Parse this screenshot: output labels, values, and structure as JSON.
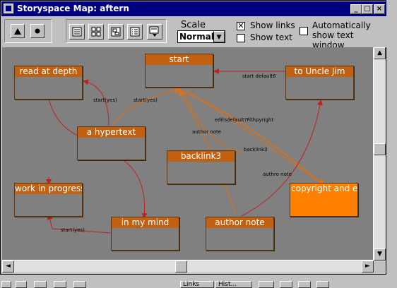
{
  "window": {
    "title": "Storyspace Map: aftern",
    "controls": {
      "minimize": "_",
      "maximize": "□",
      "close": "×"
    }
  },
  "toolbar": {
    "nav_up_icon": "triangle-up-icon",
    "nav_dot_icon": "dot-icon",
    "view_buttons": [
      "map-view-icon",
      "chart-view-icon",
      "outline-view-icon",
      "treemap-view-icon",
      "explorer-view-icon"
    ],
    "scale_label": "Scale",
    "scale_value": "Normal",
    "show_links_label": "Show links",
    "show_links_checked": true,
    "show_links_mark": "✕",
    "show_text_label": "Show text",
    "show_text_checked": false,
    "auto_text_label_line1": "Automatically",
    "auto_text_label_line2": "show text window",
    "auto_text_checked": false
  },
  "map": {
    "background": "#808080",
    "title_color": "#c06010",
    "selected_color": "#ff8000",
    "link_color_red": "#c02020",
    "link_color_orange": "#e07010",
    "nodes": [
      {
        "id": "start",
        "title": "start",
        "selected": false
      },
      {
        "id": "read-at-depth",
        "title": "read at depth",
        "selected": false
      },
      {
        "id": "to-uncle-jim",
        "title": "to Uncle Jim",
        "selected": false
      },
      {
        "id": "a-hypertext",
        "title": "a hypertext",
        "selected": false
      },
      {
        "id": "backlink3",
        "title": "backlink3",
        "selected": false
      },
      {
        "id": "copyright-and-edi",
        "title": "copyright and edi",
        "selected": true
      },
      {
        "id": "work-in-progress",
        "title": "work in progress",
        "selected": false
      },
      {
        "id": "in-my-mind",
        "title": "in my mind",
        "selected": false
      },
      {
        "id": "author-note",
        "title": "author note",
        "selected": false
      }
    ],
    "link_labels": {
      "start_default": "start default6",
      "start_yes_1": "start(yes)",
      "start_yes_2": "start(yes)",
      "edit_overlap": "editsdefault?Fithpyright",
      "author_note": "author note",
      "backlink3": "backlink3",
      "authro_note": "authro note",
      "start_yes_3": "start(yes)"
    }
  },
  "scrollbars": {
    "up_arrow": "▲",
    "down_arrow": "▼",
    "left_arrow": "◄",
    "right_arrow": "►"
  },
  "taskstrip": {
    "items": [
      "Links",
      "Hist..."
    ]
  }
}
